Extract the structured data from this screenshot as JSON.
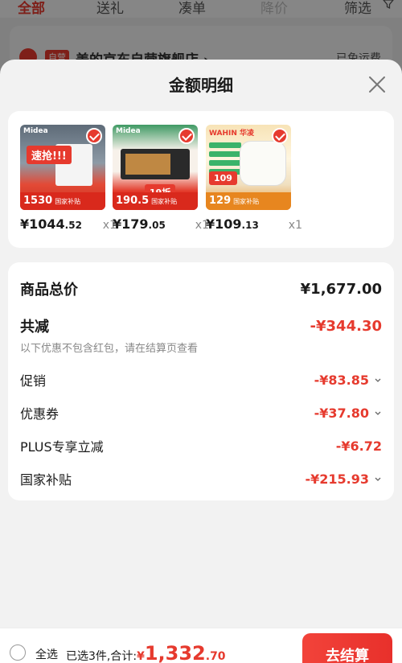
{
  "background": {
    "tabs": [
      "全部",
      "送礼",
      "凑单",
      "降价",
      "筛选"
    ],
    "store_badge": "自营",
    "store_name": "美的京东自营旗舰店 ›",
    "shipping": "已免运费"
  },
  "sheet": {
    "title": "金额明细"
  },
  "products": [
    {
      "price_int": "¥1044",
      "price_dec": ".52",
      "qty": "x1",
      "brand": "Midea",
      "promo": "速抢!!!",
      "strip": "1530",
      "strip_sub": "国家补贴",
      "theme": "thumb1"
    },
    {
      "price_int": "¥179",
      "price_dec": ".05",
      "qty": "x1",
      "brand": "Midea",
      "promo": "19折",
      "strip": "190.5",
      "strip_sub": "国家补贴",
      "theme": "thumb2"
    },
    {
      "price_int": "¥109",
      "price_dec": ".13",
      "qty": "x1",
      "brand": "WAHIN 华凌",
      "promo": "109",
      "strip": "129",
      "strip_sub": "国家补贴",
      "theme": "thumb3"
    }
  ],
  "summary": {
    "total_label": "商品总价",
    "total_value": "¥1,677.00",
    "reduce_label": "共减",
    "reduce_value": "-¥344.30",
    "note": "以下优惠不包含红包，请在结算页查看",
    "items": [
      {
        "label": "促销",
        "value": "-¥83.85",
        "expandable": true
      },
      {
        "label": "优惠券",
        "value": "-¥37.80",
        "expandable": true
      },
      {
        "label": "PLUS专享立减",
        "value": "-¥6.72",
        "expandable": false
      },
      {
        "label": "国家补贴",
        "value": "-¥215.93",
        "expandable": true
      }
    ]
  },
  "bottom_bar": {
    "select_all": "全选",
    "selected_text": "已选3件,合计:",
    "total_symbol": "¥",
    "total_int": "1,332",
    "total_dec": ".70",
    "checkout": "去结算"
  },
  "colors": {
    "accent": "#e63a2e",
    "sheet_bg": "#f2f2f2"
  }
}
